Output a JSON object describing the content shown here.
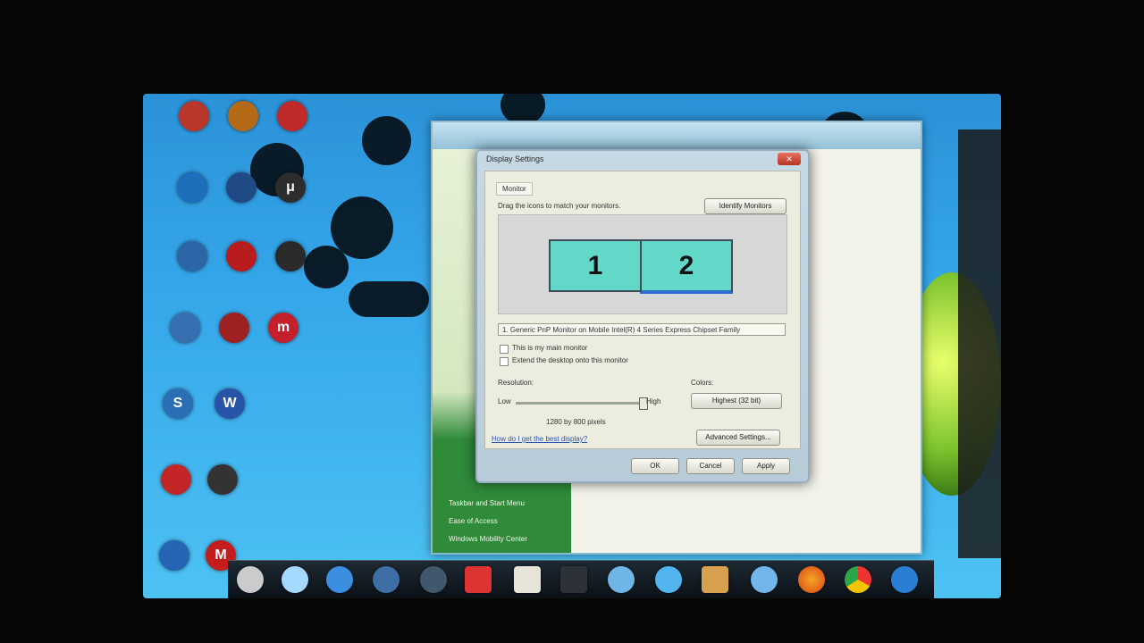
{
  "desktop": {
    "icons": [
      {
        "label": "",
        "color": "#b9372a"
      },
      {
        "label": "",
        "color": "#b56a18"
      },
      {
        "label": "",
        "color": "#c02a2a"
      },
      {
        "label": "",
        "color": "#1d6fbc"
      },
      {
        "label": "",
        "color": "#204a85"
      },
      {
        "label": "μ",
        "color": "#2d2d2d"
      },
      {
        "label": "",
        "color": "#2c66a6"
      },
      {
        "label": "",
        "color": "#b81c1c"
      },
      {
        "label": "",
        "color": "#2a2a2a"
      },
      {
        "label": "",
        "color": "#376fb0"
      },
      {
        "label": "",
        "color": "#9d2121"
      },
      {
        "label": "m",
        "color": "#c4202c"
      },
      {
        "label": "S",
        "color": "#2a6fb4"
      },
      {
        "label": "W",
        "color": "#2753a8"
      },
      {
        "label": "",
        "color": "#c22626"
      },
      {
        "label": "",
        "color": "#333"
      },
      {
        "label": "",
        "color": "#2664b4"
      },
      {
        "label": "M",
        "color": "#c31d1d"
      }
    ]
  },
  "control_panel": {
    "left_links": [
      "Taskbar and Start Menu",
      "Ease of Access",
      "Windows Mobility Center"
    ]
  },
  "dialog": {
    "title": "Display Settings",
    "tab": "Monitor",
    "instruction": "Drag the icons to match your monitors.",
    "identify_button": "Identify Monitors",
    "monitors": [
      "1",
      "2"
    ],
    "monitor_combo": "1. Generic PnP Monitor on Mobile Intel(R) 4 Series Express Chipset Family",
    "checkbox1": "This is my main monitor",
    "checkbox2": "Extend the desktop onto this monitor",
    "resolution_label": "Resolution:",
    "low": "Low",
    "high": "High",
    "colors_label": "Colors:",
    "colors_value": "Highest (32 bit)",
    "resolution_value": "1280 by 800 pixels",
    "advanced_button": "Advanced Settings...",
    "help_link": "How do I get the best display?",
    "ok": "OK",
    "cancel": "Cancel",
    "apply": "Apply"
  },
  "colors": {
    "desktop_blue": "#35a7ea",
    "monitor_tile": "#62d8c9",
    "left_pane_green": "#2f8a3a"
  }
}
